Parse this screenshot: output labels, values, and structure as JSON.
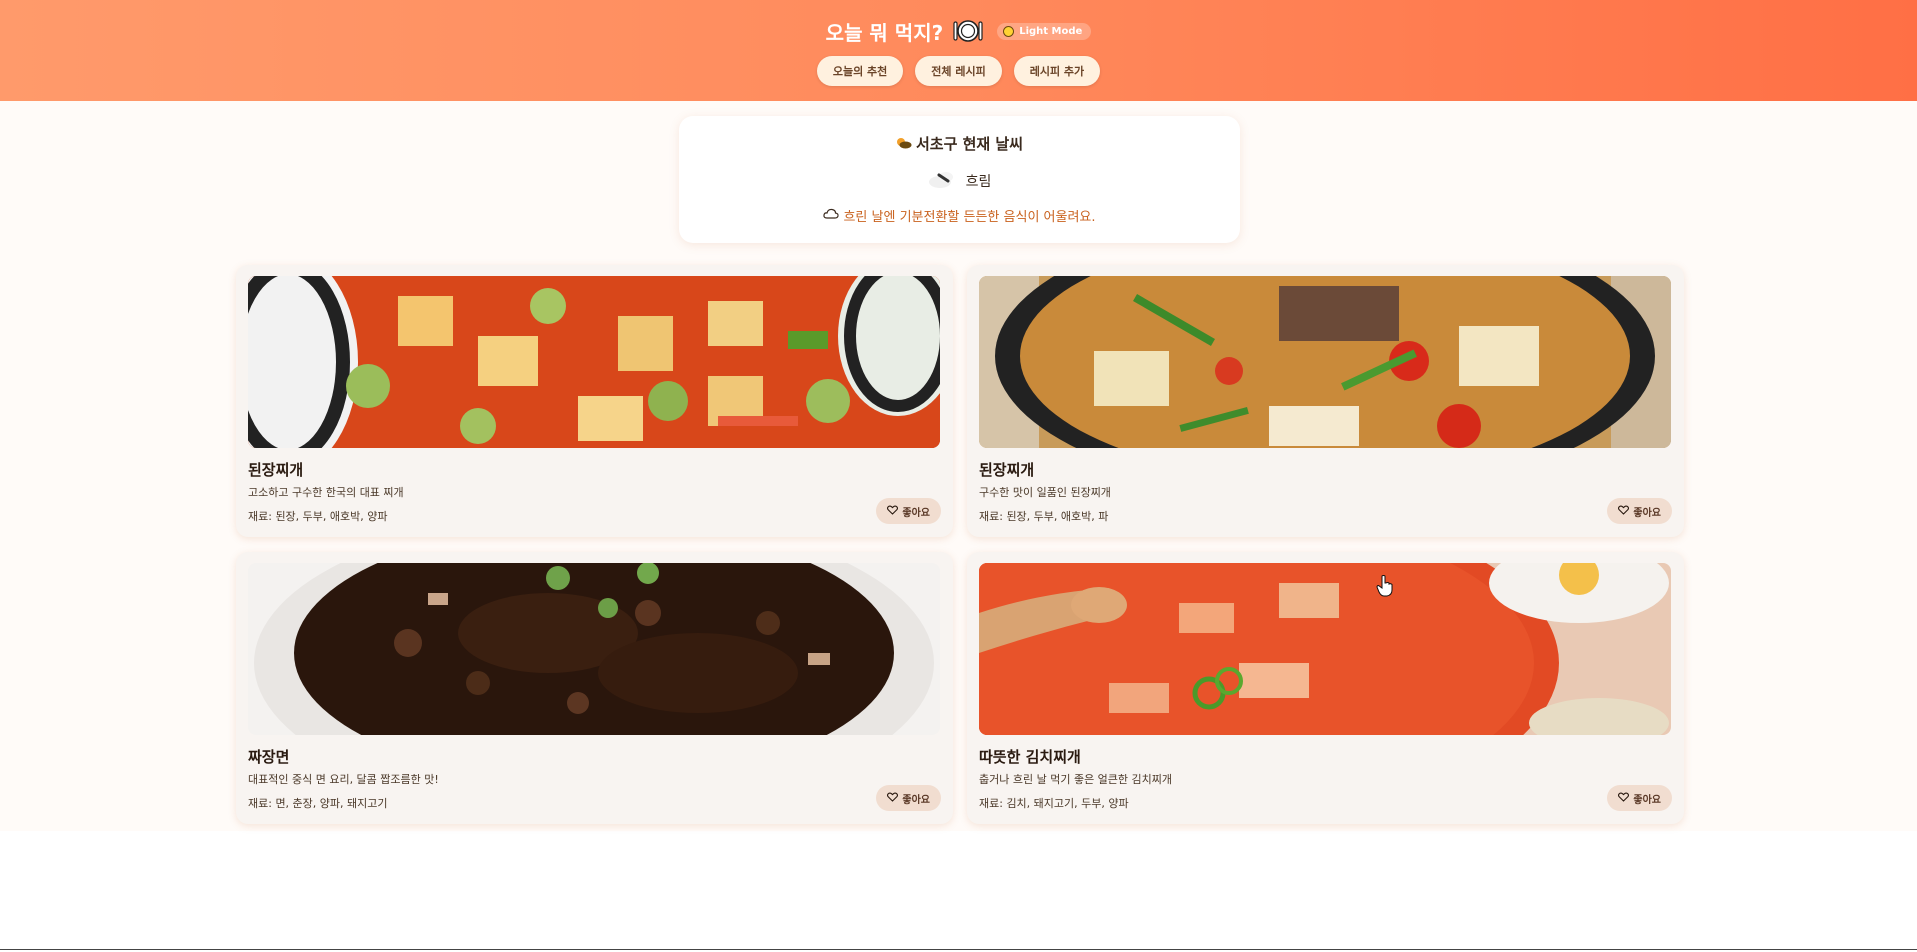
{
  "header": {
    "title": "오늘 뭐 먹지?",
    "plate_icon": "plate-cutlery-icon",
    "mode_toggle": "Light Mode",
    "nav": [
      {
        "label": "오늘의 추천"
      },
      {
        "label": "전체 레시피"
      },
      {
        "label": "레시피 추가"
      }
    ]
  },
  "weather": {
    "title": "서초구 현재 날씨",
    "title_icon": "sun-behind-cloud-icon",
    "state": "흐림",
    "state_icon": "cloud-icon",
    "message": "흐린 날엔 기분전환할 든든한 음식이 어울려요.",
    "message_icon": "cloud-outline-icon"
  },
  "recipes": [
    {
      "name": "된장찌개",
      "description": "고소하고 구수한 한국의 대표 찌개",
      "ingredients": "재료: 된장, 두부, 애호박, 양파",
      "like_label": "좋아요"
    },
    {
      "name": "된장찌개",
      "description": "구수한 맛이 일품인 된장찌개",
      "ingredients": "재료: 된장, 두부, 애호박, 파",
      "like_label": "좋아요"
    },
    {
      "name": "짜장면",
      "description": "대표적인 중식 면 요리, 달콤 짭조름한 맛!",
      "ingredients": "재료: 면, 춘장, 양파, 돼지고기",
      "like_label": "좋아요"
    },
    {
      "name": "따뜻한 김치찌개",
      "description": "춥거나 흐린 날 먹기 좋은 얼큰한 김치찌개",
      "ingredients": "재료: 김치, 돼지고기, 두부, 양파",
      "like_label": "좋아요"
    }
  ],
  "colors": {
    "header_start": "#ff9a6b",
    "header_end": "#ff6f45",
    "accent_text": "#c9621f",
    "card_bg": "#f8f4f1",
    "like_bg": "#f1ddd0"
  }
}
